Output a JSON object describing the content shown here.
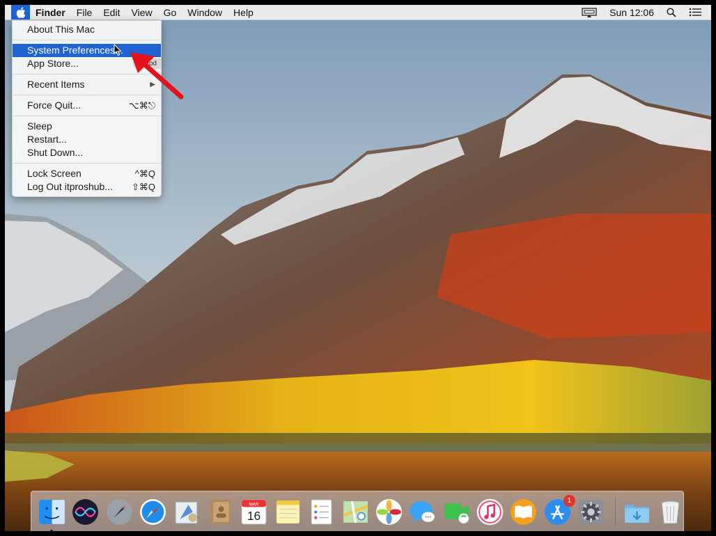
{
  "menubar": {
    "apple": "",
    "app_name": "Finder",
    "menus": [
      "File",
      "Edit",
      "View",
      "Go",
      "Window",
      "Help"
    ],
    "clock": "Sun 12:06",
    "icons": [
      "apple-icon",
      "airplay-display-icon",
      "spotlight-search-icon",
      "notification-center-icon"
    ]
  },
  "apple_menu": {
    "about": "About This Mac",
    "system_preferences": "System Preferences...",
    "app_store": "App Store...",
    "app_store_badge": "1 upd",
    "recent_items": "Recent Items",
    "recent_items_arrow": "▶",
    "force_quit": "Force Quit...",
    "force_quit_shortcut": "⌥⌘⎋",
    "sleep": "Sleep",
    "restart": "Restart...",
    "shut_down": "Shut Down...",
    "lock_screen": "Lock Screen",
    "lock_screen_shortcut": "^⌘Q",
    "log_out": "Log Out itproshub...",
    "log_out_shortcut": "⇧⌘Q"
  },
  "dock": {
    "calendar_month": "MAR",
    "calendar_day": "16",
    "app_store_badge": "1",
    "icons": [
      "finder-icon",
      "siri-icon",
      "launchpad-icon",
      "safari-icon",
      "mail-icon",
      "contacts-icon",
      "calendar-icon",
      "notes-icon",
      "reminders-icon",
      "maps-icon",
      "photos-icon",
      "messages-icon",
      "facetime-icon",
      "itunes-icon",
      "ibooks-icon",
      "app-store-icon",
      "system-preferences-icon",
      "downloads-folder-icon",
      "trash-icon"
    ]
  },
  "colors": {
    "highlight": "#1f63d3",
    "annotation_arrow": "#e3121b"
  }
}
